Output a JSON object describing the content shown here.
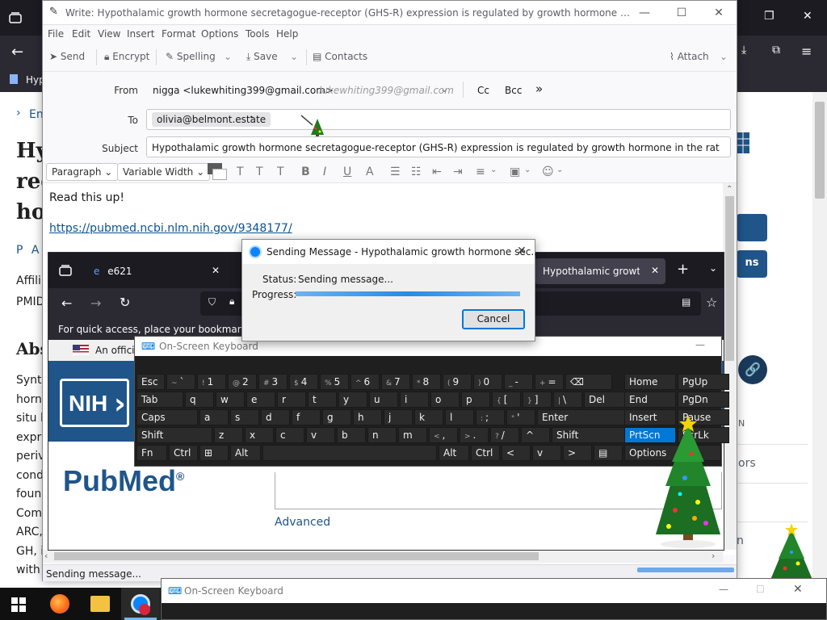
{
  "background_browser": {
    "bookmark_label": "Hyp",
    "page": {
      "breadcrumb_fragment": "En",
      "heading_fragments": [
        "Hy",
        "rec",
        "ho"
      ],
      "authors_fragment": "P A",
      "affil_fragment": "Affili",
      "pmid_fragment": "PMID",
      "abs_fragment": "Abs",
      "abstract_fragments": [
        "Synt",
        "horn",
        "situ l",
        "expr",
        "periv",
        "cond",
        "foun",
        "Com",
        "ARC,",
        "GH, i",
        "with"
      ],
      "right_btn1": "",
      "right_btn2": "ns",
      "right_text1": "N",
      "right_text2": "ors",
      "right_text3": "n"
    }
  },
  "compose": {
    "title": "Write: Hypothalamic growth hormone secretagogue-receptor (GHS-R) expression is regulated by growth hormone in the rat - Th...",
    "menu": [
      "File",
      "Edit",
      "View",
      "Insert",
      "Format",
      "Options",
      "Tools",
      "Help"
    ],
    "toolbar": {
      "send": "Send",
      "encrypt": "Encrypt",
      "spelling": "Spelling",
      "save": "Save",
      "contacts": "Contacts",
      "attach": "Attach"
    },
    "from_label": "From",
    "from_value": "nigga <lukewhiting399@gmail.com>",
    "from_identity": "lukewhiting399@gmail.com",
    "cc": "Cc",
    "bcc": "Bcc",
    "more": "»",
    "to_label": "To",
    "to_value": "olivia@belmont.estate",
    "subject_label": "Subject",
    "subject_value": "Hypothalamic growth hormone secretagogue-receptor (GHS-R) expression is regulated by growth hormone in the rat",
    "format": {
      "paragraph": "Paragraph",
      "width": "Variable Width"
    },
    "body_line1": "Read this up!",
    "body_link": "https://pubmed.ncbi.nlm.nih.gov/9348177/",
    "status": "Sending message..."
  },
  "inner_browser": {
    "tab1": "e621",
    "tab2": "Hypothalamic growth h",
    "bookmark_hint": "For quick access, place your bookmarks here",
    "gov_banner": "An officia",
    "pubmed_logo": "PubMed",
    "advanced": "Advanced"
  },
  "dialog": {
    "title": "Sending Message - Hypothalamic growth hormone sec...",
    "status_label": "Status:",
    "status_value": "Sending message...",
    "progress_label": "Progress:",
    "progress": 1.0,
    "cancel": "Cancel"
  },
  "osk": {
    "title": "On-Screen Keyboard",
    "rows": [
      [
        [
          "Esc",
          ""
        ],
        [
          "`",
          "~"
        ],
        [
          "1",
          "!"
        ],
        [
          "2",
          "@"
        ],
        [
          "3",
          "#"
        ],
        [
          "4",
          "$"
        ],
        [
          "5",
          "%"
        ],
        [
          "6",
          "^"
        ],
        [
          "7",
          "&"
        ],
        [
          "8",
          "*"
        ],
        [
          "9",
          "("
        ],
        [
          "0",
          ")"
        ],
        [
          "-",
          "_"
        ],
        [
          "=",
          "+"
        ],
        [
          "⌫",
          ""
        ]
      ],
      [
        [
          "Tab",
          ""
        ],
        [
          "q",
          ""
        ],
        [
          "w",
          ""
        ],
        [
          "e",
          ""
        ],
        [
          "r",
          ""
        ],
        [
          "t",
          ""
        ],
        [
          "y",
          ""
        ],
        [
          "u",
          ""
        ],
        [
          "i",
          ""
        ],
        [
          "o",
          ""
        ],
        [
          "p",
          ""
        ],
        [
          "[",
          "{"
        ],
        [
          "]",
          "}"
        ],
        [
          "\\",
          "|"
        ],
        [
          "Del",
          ""
        ]
      ],
      [
        [
          "Caps",
          ""
        ],
        [
          "a",
          ""
        ],
        [
          "s",
          ""
        ],
        [
          "d",
          ""
        ],
        [
          "f",
          ""
        ],
        [
          "g",
          ""
        ],
        [
          "h",
          ""
        ],
        [
          "j",
          ""
        ],
        [
          "k",
          ""
        ],
        [
          "l",
          ""
        ],
        [
          ";",
          ":"
        ],
        [
          "'",
          "\""
        ],
        [
          "Enter",
          ""
        ]
      ],
      [
        [
          "Shift",
          ""
        ],
        [
          "z",
          ""
        ],
        [
          "x",
          ""
        ],
        [
          "c",
          ""
        ],
        [
          "v",
          ""
        ],
        [
          "b",
          ""
        ],
        [
          "n",
          ""
        ],
        [
          "m",
          ""
        ],
        [
          ",",
          "<"
        ],
        [
          ".",
          ">"
        ],
        [
          "/",
          "?"
        ],
        [
          "^",
          ""
        ],
        [
          "Shift",
          ""
        ]
      ],
      [
        [
          "Fn",
          ""
        ],
        [
          "Ctrl",
          ""
        ],
        [
          "⊞",
          ""
        ],
        [
          "Alt",
          ""
        ],
        [
          "",
          ""
        ],
        [
          "Alt",
          ""
        ],
        [
          "Ctrl",
          ""
        ],
        [
          "<",
          ""
        ],
        [
          "v",
          ""
        ],
        [
          ">",
          ""
        ],
        [
          "▤",
          ""
        ]
      ]
    ],
    "side": [
      [
        "Home",
        "PgUp"
      ],
      [
        "End",
        "PgDn"
      ],
      [
        "Insert",
        "Pause"
      ],
      [
        "PrtScn",
        "ScrLk"
      ],
      [
        "Options",
        ""
      ]
    ]
  },
  "osk_bottom": {
    "title": "On-Screen Keyboard"
  },
  "colors": {
    "accent": "#0078d7",
    "pubmed_blue": "#20558a",
    "link": "#0b5394"
  }
}
